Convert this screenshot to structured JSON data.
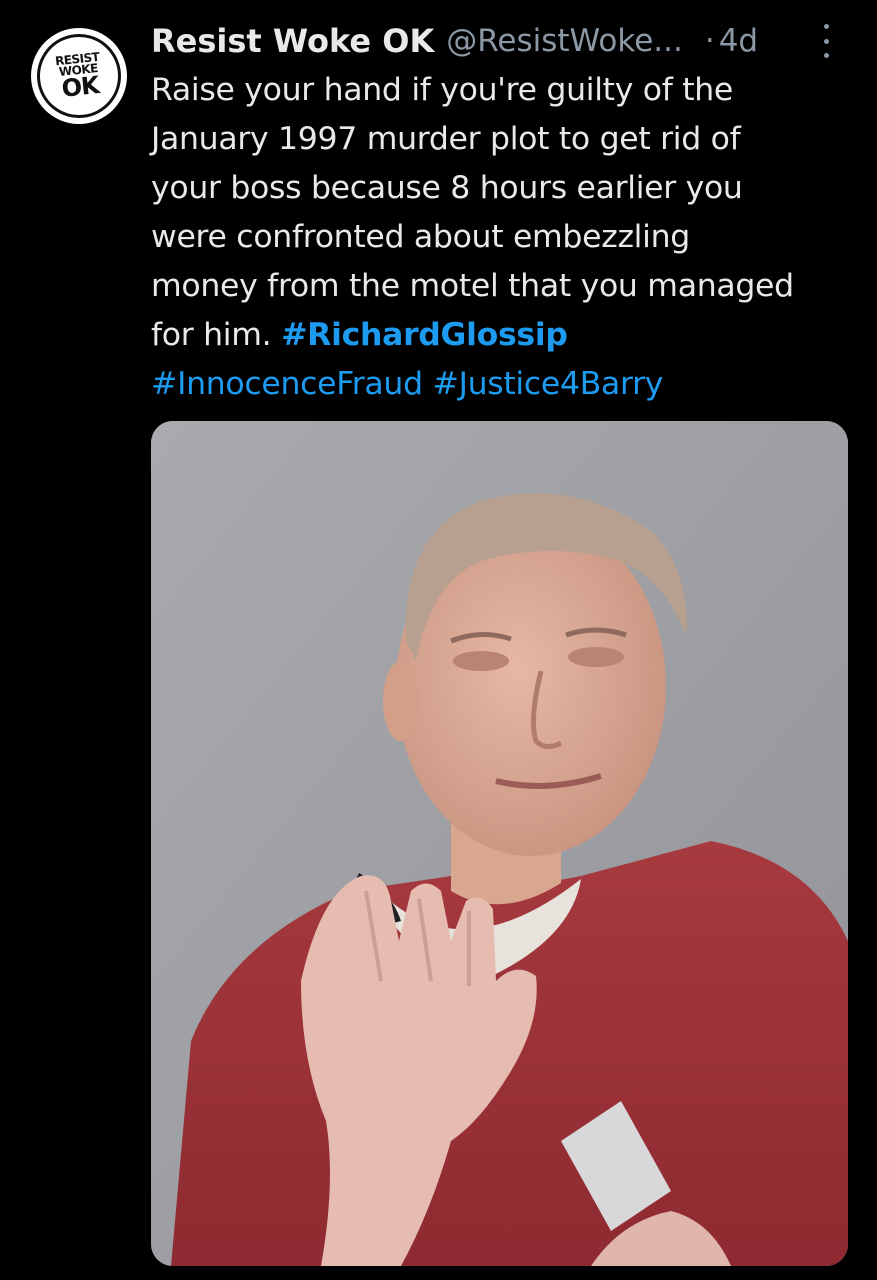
{
  "tweet": {
    "author_name": "Resist Woke OK",
    "author_handle": "@ResistWoke...",
    "separator": "·",
    "time": "4d",
    "avatar_text": [
      "RESIST",
      "WOKE",
      "OK"
    ],
    "text_lines": [
      "Raise your hand if you're guilty of the",
      "January 1997 murder plot to get rid of",
      "your boss because 8 hours earlier you",
      "were confronted about embezzling",
      "money from the motel that you managed"
    ],
    "text_last_prefix": "for him. ",
    "hashtags": [
      "#RichardGlossip",
      "#InnocenceFraud",
      "#Justice4Barry"
    ],
    "media_icon": "photo-man-raising-hand"
  },
  "colors": {
    "background": "#000000",
    "text": "#e7e9ea",
    "secondary": "#8b98a5",
    "link": "#1d9bf0"
  }
}
